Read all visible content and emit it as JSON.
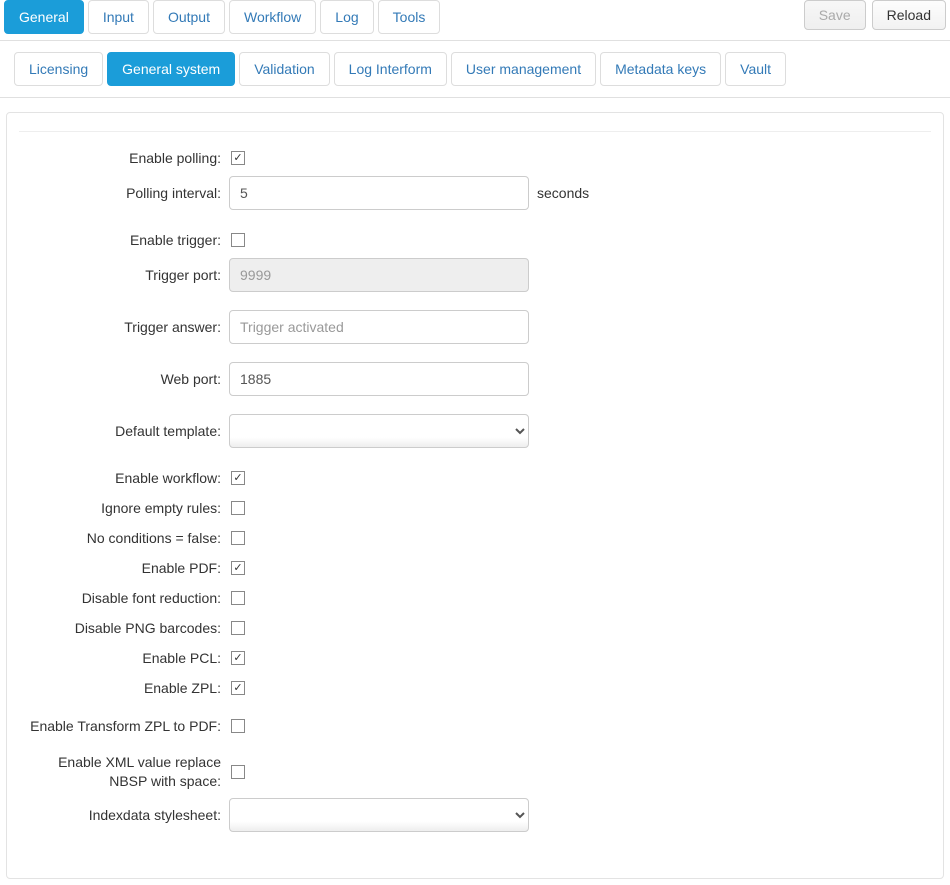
{
  "top_tabs": [
    "General",
    "Input",
    "Output",
    "Workflow",
    "Log",
    "Tools"
  ],
  "top_active_index": 0,
  "buttons": {
    "save": "Save",
    "reload": "Reload"
  },
  "sub_tabs": [
    "Licensing",
    "General system",
    "Validation",
    "Log Interform",
    "User management",
    "Metadata keys",
    "Vault"
  ],
  "sub_active_index": 1,
  "form": {
    "enable_polling": {
      "label": "Enable polling:",
      "checked": true
    },
    "polling_interval": {
      "label": "Polling interval:",
      "value": "5",
      "unit": "seconds"
    },
    "enable_trigger": {
      "label": "Enable trigger:",
      "checked": false
    },
    "trigger_port": {
      "label": "Trigger port:",
      "value": "9999",
      "disabled": true
    },
    "trigger_answer": {
      "label": "Trigger answer:",
      "placeholder": "Trigger activated",
      "value": ""
    },
    "web_port": {
      "label": "Web port:",
      "value": "1885"
    },
    "default_template": {
      "label": "Default template:",
      "value": ""
    },
    "enable_workflow": {
      "label": "Enable workflow:",
      "checked": true
    },
    "ignore_empty_rules": {
      "label": "Ignore empty rules:",
      "checked": false
    },
    "no_conditions_false": {
      "label": "No conditions = false:",
      "checked": false
    },
    "enable_pdf": {
      "label": "Enable PDF:",
      "checked": true
    },
    "disable_font_reduction": {
      "label": "Disable font reduction:",
      "checked": false
    },
    "disable_png_barcodes": {
      "label": "Disable PNG barcodes:",
      "checked": false
    },
    "enable_pcl": {
      "label": "Enable PCL:",
      "checked": true
    },
    "enable_zpl": {
      "label": "Enable ZPL:",
      "checked": true
    },
    "enable_transform_zpl_pdf": {
      "label": "Enable Transform ZPL to PDF:",
      "checked": false
    },
    "enable_xml_nbsp": {
      "label": "Enable XML value replace NBSP with space:",
      "checked": false
    },
    "indexdata_stylesheet": {
      "label": "Indexdata stylesheet:",
      "value": ""
    }
  }
}
